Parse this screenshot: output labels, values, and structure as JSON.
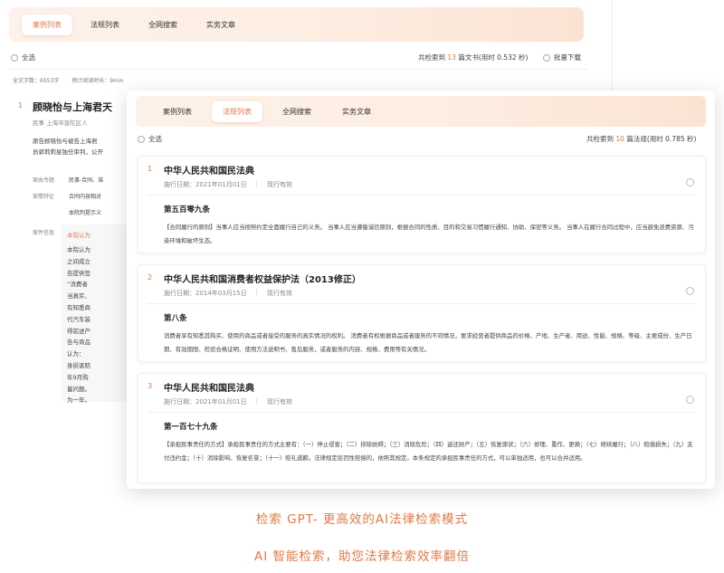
{
  "back_window": {
    "tabs": [
      {
        "label": "案例列表",
        "active": true
      },
      {
        "label": "法规列表",
        "active": false
      },
      {
        "label": "全网搜索",
        "active": false
      },
      {
        "label": "实务文章",
        "active": false
      }
    ],
    "select_all": "全选",
    "result_prefix": "共检索到",
    "result_count": "13",
    "result_suffix": "篇文书(用时 0.532 秒)",
    "batch_download": "批量下载",
    "stats": [
      "全文字数：6553字",
      "预计阅读时长：9min"
    ],
    "case": {
      "index": "1",
      "title": "顾晓怡与上海君天",
      "meta": "民事   上海市普陀区人",
      "summary": "原告顾晓怡与被告上海君",
      "summary2": "员郭莉莉星独任审判，公开",
      "labels": [
        {
          "label": "案由专题",
          "value": "民事-合同、准"
        },
        {
          "label": "案情特征",
          "value": "合同内容相对"
        },
        {
          "label": "",
          "value": "本院判提示义"
        }
      ],
      "info_label": "案件信息",
      "info_header": "本院认为",
      "info_lines": [
        "本院认为",
        "之间成立",
        "告提供签",
        "“消费者",
        "当真实、",
        "有知悉商",
        "代汽车装",
        "得前述产",
        "告与商品",
        "认为：",
        "身损害赔",
        "年9月购",
        "量问题。",
        "为一年。"
      ]
    }
  },
  "front_window": {
    "tabs": [
      {
        "label": "案例列表",
        "active": false
      },
      {
        "label": "法规列表",
        "active": true
      },
      {
        "label": "全网搜索",
        "active": false
      },
      {
        "label": "实务文章",
        "active": false
      }
    ],
    "select_all": "全选",
    "result_prefix": "共检索到",
    "result_count": "10",
    "result_suffix": "篇法规(用时 0.785 秒)",
    "results": [
      {
        "index": "1",
        "title": "中华人民共和国民法典",
        "date": "施行日期：2021年01月01日",
        "status": "现行有效",
        "article": "第五百零九条",
        "body": "【合同履行的原则】当事人应当按照约定全面履行自己的义务。 当事人应当遵循诚信原则，根据合同的性质、目的和交易习惯履行通知、协助、保密等义务。 当事人在履行合同过程中，应当避免浪费资源、污染环境和破坏生态。"
      },
      {
        "index": "2",
        "title": "中华人民共和国消费者权益保护法（2013修正）",
        "date": "施行日期：2014年03月15日",
        "status": "现行有效",
        "article": "第八条",
        "body": "消费者享有知悉其购买、使用的商品或者接受的服务的真实情况的权利。 消费者有权根据商品或者服务的不同情况，要求经营者提供商品的价格、产地、生产者、用途、性能、规格、等级、主要成份、生产日期、有效期限、检验合格证明、使用方法说明书、售后服务，或者服务的内容、规格、费用等有关情况。"
      },
      {
        "index": "3",
        "title": "中华人民共和国民法典",
        "date": "施行日期：2021年01月01日",
        "status": "现行有效",
        "article": "第一百七十九条",
        "body": "【承担民事责任的方式】承担民事责任的方式主要有：（一）停止侵害；（二）排除妨碍；（三）消除危险；（四）返还财产；（五）恢复原状；（六）修理、重作、更换；（七）继续履行；（八）赔偿损失；（九）支付违约金；（十）消除影响、恢复名誉；（十一）赔礼道歉。法律规定惩罚性赔偿的，依照其规定。本条规定的承担民事责任的方式，可以单独适用，也可以合并适用。"
      }
    ]
  },
  "captions": {
    "line1": "检索 GPT- 更高效的AI法律检索模式",
    "line2": "AI 智能检索，助您法律检索效率翻倍"
  },
  "colors": {
    "accent": "#e07a44",
    "tab_bar": "#fdeee3"
  }
}
